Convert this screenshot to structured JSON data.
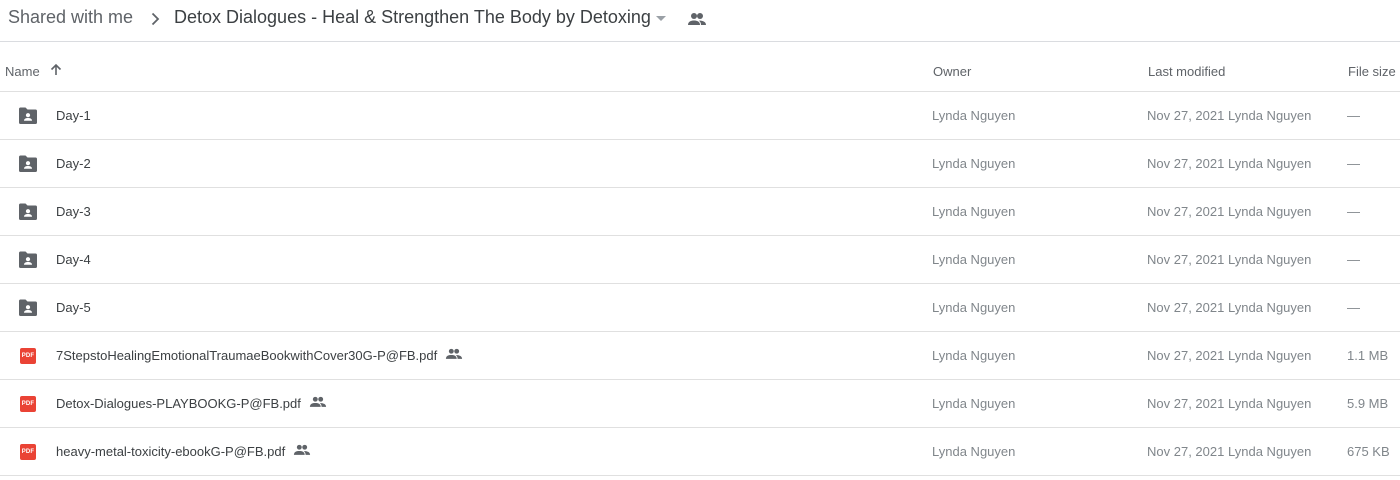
{
  "breadcrumb": {
    "root": "Shared with me",
    "current": "Detox Dialogues - Heal & Strengthen The Body by Detoxing"
  },
  "columns": {
    "name": "Name",
    "owner": "Owner",
    "last_modified": "Last modified",
    "file_size": "File size"
  },
  "colors": {
    "folder_icon": "#5f6368",
    "pdf_icon": "#ea4335",
    "divider": "#e0e0e0"
  },
  "pdf_label": "PDF",
  "rows": [
    {
      "name": "Day-1",
      "type": "folder-shared-icon",
      "owner": "Lynda Nguyen",
      "modified_date": "Nov 27, 2021",
      "modified_by": "Lynda Nguyen",
      "size": "—"
    },
    {
      "name": "Day-2",
      "type": "folder-shared-icon",
      "owner": "Lynda Nguyen",
      "modified_date": "Nov 27, 2021",
      "modified_by": "Lynda Nguyen",
      "size": "—"
    },
    {
      "name": "Day-3",
      "type": "folder-shared-icon",
      "owner": "Lynda Nguyen",
      "modified_date": "Nov 27, 2021",
      "modified_by": "Lynda Nguyen",
      "size": "—"
    },
    {
      "name": "Day-4",
      "type": "folder-shared-icon",
      "owner": "Lynda Nguyen",
      "modified_date": "Nov 27, 2021",
      "modified_by": "Lynda Nguyen",
      "size": "—"
    },
    {
      "name": "Day-5",
      "type": "folder-shared-icon",
      "owner": "Lynda Nguyen",
      "modified_date": "Nov 27, 2021",
      "modified_by": "Lynda Nguyen",
      "size": "—"
    },
    {
      "name": "7StepstoHealingEmotionalTraumaeBookwithCover30G-P@FB.pdf",
      "type": "pdf-icon",
      "owner": "Lynda Nguyen",
      "modified_date": "Nov 27, 2021",
      "modified_by": "Lynda Nguyen",
      "size": "1.1 MB"
    },
    {
      "name": "Detox-Dialogues-PLAYBOOKG-P@FB.pdf",
      "type": "pdf-icon",
      "owner": "Lynda Nguyen",
      "modified_date": "Nov 27, 2021",
      "modified_by": "Lynda Nguyen",
      "size": "5.9 MB"
    },
    {
      "name": "heavy-metal-toxicity-ebookG-P@FB.pdf",
      "type": "pdf-icon",
      "owner": "Lynda Nguyen",
      "modified_date": "Nov 27, 2021",
      "modified_by": "Lynda Nguyen",
      "size": "675 KB"
    }
  ]
}
